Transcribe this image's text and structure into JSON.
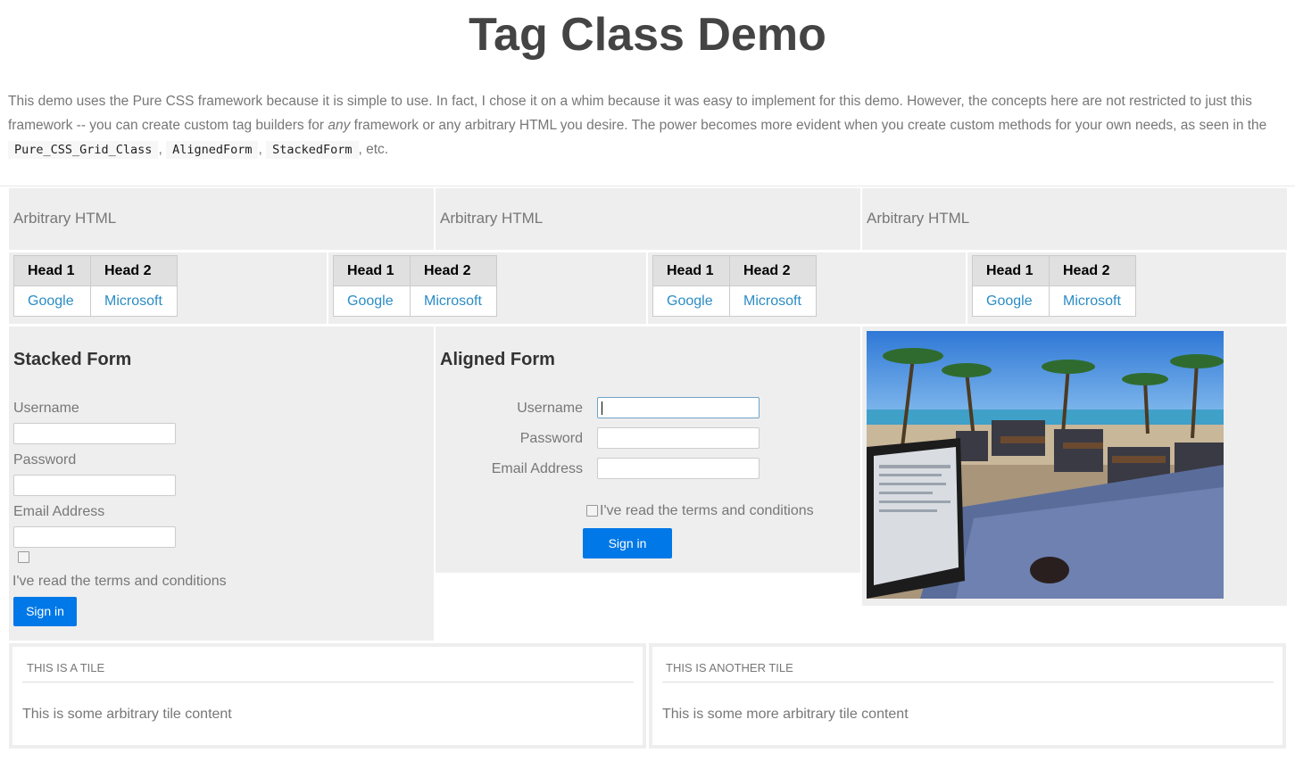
{
  "page": {
    "title": "Tag Class Demo",
    "intro_part1": "This demo uses the Pure CSS framework because it is simple to use. In fact, I chose it on a whim because it was easy to implement for this demo. However, the concepts here are not restricted to just this framework -- you can create custom tag builders for ",
    "intro_em": "any",
    "intro_part2": " framework or any arbitrary HTML you desire. The power becomes more evident when you create custom methods for your own needs, as seen in the ",
    "intro_codes": [
      "Pure_CSS_Grid_Class",
      "AlignedForm",
      "StackedForm"
    ],
    "intro_sep": ",",
    "intro_end": ", etc."
  },
  "arbitrary_cells": [
    "Arbitrary HTML",
    "Arbitrary HTML",
    "Arbitrary HTML"
  ],
  "tables": [
    {
      "headers": [
        "Head 1",
        "Head 2"
      ],
      "links": [
        "Google",
        "Microsoft"
      ]
    },
    {
      "headers": [
        "Head 1",
        "Head 2"
      ],
      "links": [
        "Google",
        "Microsoft"
      ]
    },
    {
      "headers": [
        "Head 1",
        "Head 2"
      ],
      "links": [
        "Google",
        "Microsoft"
      ]
    },
    {
      "headers": [
        "Head 1",
        "Head 2"
      ],
      "links": [
        "Google",
        "Microsoft"
      ]
    }
  ],
  "stacked_form": {
    "title": "Stacked Form",
    "username_label": "Username",
    "password_label": "Password",
    "email_label": "Email Address",
    "terms_label": "I've read the terms and conditions",
    "submit_label": "Sign in"
  },
  "aligned_form": {
    "title": "Aligned Form",
    "username_label": "Username",
    "password_label": "Password",
    "email_label": "Email Address",
    "terms_label": "I've read the terms and conditions",
    "submit_label": "Sign in"
  },
  "tiles": [
    {
      "heading": "This is a tile",
      "content": "This is some arbitrary tile content"
    },
    {
      "heading": "This is another tile",
      "content": "This is some more arbitrary tile content"
    }
  ]
}
